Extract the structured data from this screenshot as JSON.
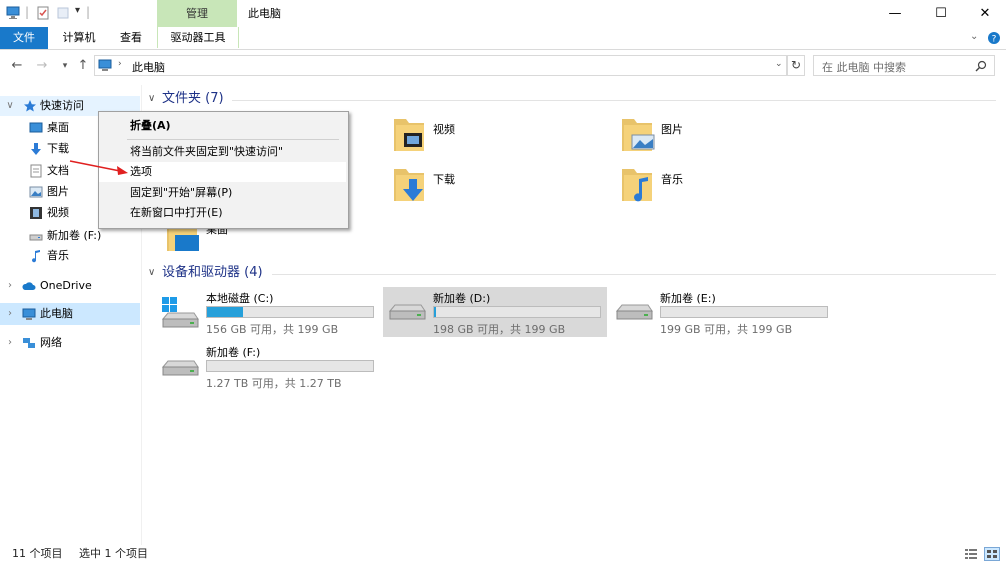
{
  "titlebar": {
    "context_group": "管理",
    "window_title": "此电脑",
    "buttons": {
      "minimize": "—",
      "maximize": "☐",
      "close": "✕"
    }
  },
  "tabs": {
    "file": "文件",
    "computer": "计算机",
    "view": "查看",
    "drive_tools": "驱动器工具"
  },
  "address": {
    "path": "此电脑",
    "search_placeholder": "在 此电脑 中搜索"
  },
  "nav": {
    "quick_access": "快速访问",
    "items": [
      {
        "label": "桌面",
        "icon": "desktop-icon"
      },
      {
        "label": "下载",
        "icon": "download-icon"
      },
      {
        "label": "文档",
        "icon": "document-icon"
      },
      {
        "label": "图片",
        "icon": "picture-icon"
      },
      {
        "label": "视频",
        "icon": "video-icon"
      },
      {
        "label": "新加卷 (F:)",
        "icon": "drive-icon"
      },
      {
        "label": "音乐",
        "icon": "music-icon"
      }
    ],
    "onedrive": "OneDrive",
    "this_pc": "此电脑",
    "network": "网络"
  },
  "folders": {
    "header": "文件夹 (7)",
    "items": [
      {
        "label": "视频"
      },
      {
        "label": "图片"
      },
      {
        "label": "下载"
      },
      {
        "label": "音乐"
      },
      {
        "label": "桌面"
      }
    ]
  },
  "devices": {
    "header": "设备和驱动器 (4)",
    "drives": [
      {
        "name": "本地磁盘 (C:)",
        "free": "156 GB 可用，共 199 GB",
        "used_fraction": 0.216
      },
      {
        "name": "新加卷 (D:)",
        "free": "198 GB 可用，共 199 GB",
        "used_fraction": 0.01
      },
      {
        "name": "新加卷 (E:)",
        "free": "199 GB 可用，共 199 GB",
        "used_fraction": 0.0
      },
      {
        "name": "新加卷 (F:)",
        "free": "1.27 TB 可用，共 1.27 TB",
        "used_fraction": 0.0
      }
    ]
  },
  "context_menu": {
    "collapse": "折叠(A)",
    "pin_quick": "将当前文件夹固定到\"快速访问\"",
    "options": "选项",
    "pin_start": "固定到\"开始\"屏幕(P)",
    "open_new": "在新窗口中打开(E)"
  },
  "status": {
    "count": "11 个项目",
    "selected": "选中 1 个项目"
  },
  "colors": {
    "accent": "#1979ca",
    "selection": "#cce8ff",
    "header_text": "#1e3287",
    "bar_fill": "#26a0da"
  }
}
